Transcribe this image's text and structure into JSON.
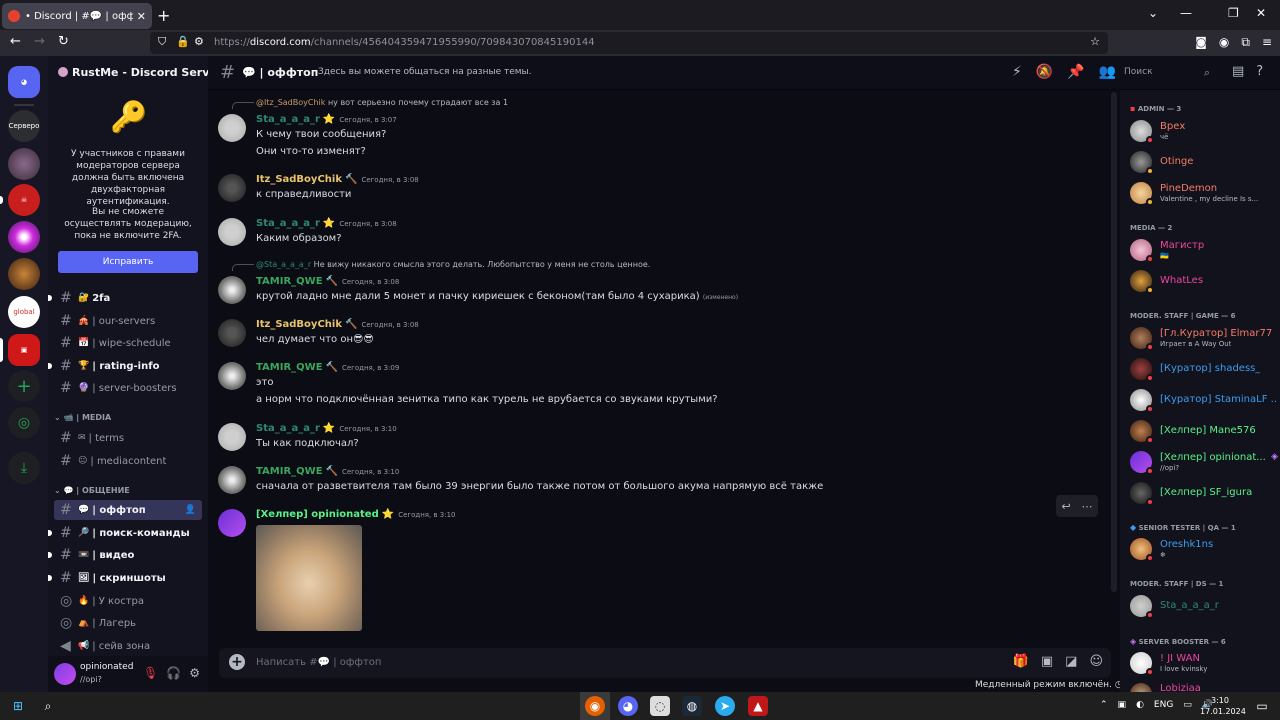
{
  "browser": {
    "tab_title": "• Discord | #💬 | оффтоп | RustMe",
    "url_prefix": "https://",
    "url_host": "discord.com",
    "url_path": "/channels/456404359471955990/709843070845190144"
  },
  "rail": {
    "servers_label": "Серверо",
    "global_label": "global"
  },
  "server": {
    "name": "RustMe - Discord Server"
  },
  "notice": {
    "text1": "У участников с правами модераторов сервера должна быть включена двухфакторная аутентификация.",
    "text2": "Вы не сможете осуществлять модерацию, пока не включите 2FA.",
    "button": "Исправить"
  },
  "channels": {
    "c1": "2fa",
    "c2": "| our-servers",
    "c3": "| wipe-schedule",
    "c4": "| rating-info",
    "c5": "| server-boosters",
    "cat_media": "| MEDIA",
    "c6": "| terms",
    "c7": "| mediacontent",
    "cat_talk": "| ОБЩЕНИЕ",
    "c8": "| оффтоп",
    "c9": "| поиск-команды",
    "c10": "| видео",
    "c11": "| скриншоты",
    "c12": "| У костра",
    "c13": "| Лагерь",
    "c14": "| сейв зона"
  },
  "user": {
    "name": "opinionated",
    "status": "//opi?"
  },
  "header": {
    "title": "| оффтоп",
    "topic": "Здесь вы можете общаться на разные темы.",
    "search_placeholder": "Поиск"
  },
  "messages": {
    "m1_reply_name": "@Itz_SadBoyChik",
    "m1_reply_text": "ну вот серьезно почему страдают все за 1",
    "m1_name": "Sta_a_a_a_r",
    "m1_time": "Сегодня, в 3:07",
    "m1_l1": "К чему твои сообщения?",
    "m1_l2": "Они что-то изменят?",
    "m2_name": "Itz_SadBoyChik",
    "m2_time": "Сегодня, в 3:08",
    "m2_l1": "к справедливости",
    "m3_name": "Sta_a_a_a_r",
    "m3_time": "Сегодня, в 3:08",
    "m3_l1": "Каким образом?",
    "m4_reply_name": "@Sta_a_a_a_r",
    "m4_reply_text": "Не вижу никакого смысла этого делать. Любопытство у меня не столь ценное.",
    "m4_name": "TAMIR_QWE",
    "m4_time": "Сегодня, в 3:08",
    "m4_l1": "крутой ладно мне дали 5 монет и пачку кириешек с беконом(там было 4 сухарика)",
    "m4_edited": "(изменено)",
    "m5_name": "Itz_SadBoyChik",
    "m5_time": "Сегодня, в 3:08",
    "m5_l1": "чел думает что он😎😎",
    "m6_name": "TAMIR_QWE",
    "m6_time": "Сегодня, в 3:09",
    "m6_l1": "это",
    "m6_l2": "а норм что подключённая зенитка типо как турель не врубается со звуками крутыми?",
    "m7_name": "Sta_a_a_a_r",
    "m7_time": "Сегодня, в 3:10",
    "m7_l1": "Ты как подключал?",
    "m8_name": "TAMIR_QWE",
    "m8_time": "Сегодня, в 3:10",
    "m8_l1": "сначала от разветвителя там было 39 энергии было также потом от большого акума напрямую всё также",
    "m9_name": "[Хелпер] opinionated",
    "m9_time": "Сегодня, в 3:10"
  },
  "composer": {
    "placeholder": "Написать #💬 | оффтоп",
    "slowmode": "Медленный режим включён."
  },
  "members": {
    "cat1": "ADMIN — 3",
    "a1": "Врех",
    "a1_sub": "чё",
    "a2": "Otinge",
    "a3": "PineDemon",
    "a3_sub": "Valentine , my decline Is s...",
    "cat2": "MEDIA — 2",
    "b1": "Магистр",
    "b1_sub": "🇺🇦",
    "b2": "WhatLes",
    "cat3": "MODER. STAFF | GAME — 6",
    "c1": "[Гл.Куратор] Elmar77",
    "c1_sub": "Играет в A Way Out",
    "c2": "[Куратор] shadess_",
    "c3": "[Куратор] StaminaLF ...",
    "c4": "[Хелпер] Mane576",
    "c5": "[Хелпер] opinionat...",
    "c5_sub": "//opi?",
    "c6": "[Хелпер] SF_igura",
    "cat4": "SENIOR TESTER | QA — 1",
    "d1": "Oreshk1ns",
    "d1_sub": "❄",
    "cat5": "MODER. STAFF | DS — 1",
    "e1": "Sta_a_a_a_r",
    "cat6": "SERVER BOOSTER — 6",
    "f1": "! JI WAN",
    "f1_sub": "I love kvinsky",
    "f2": "Lobiziaa"
  },
  "taskbar": {
    "lang": "ENG",
    "time": "3:10",
    "date": "17.01.2024"
  },
  "colors": {
    "accent": "#5865f2",
    "sta": "#2e8a6e",
    "tamir": "#3ba55c",
    "itz": "#e8c46a",
    "helper": "#57f287"
  }
}
